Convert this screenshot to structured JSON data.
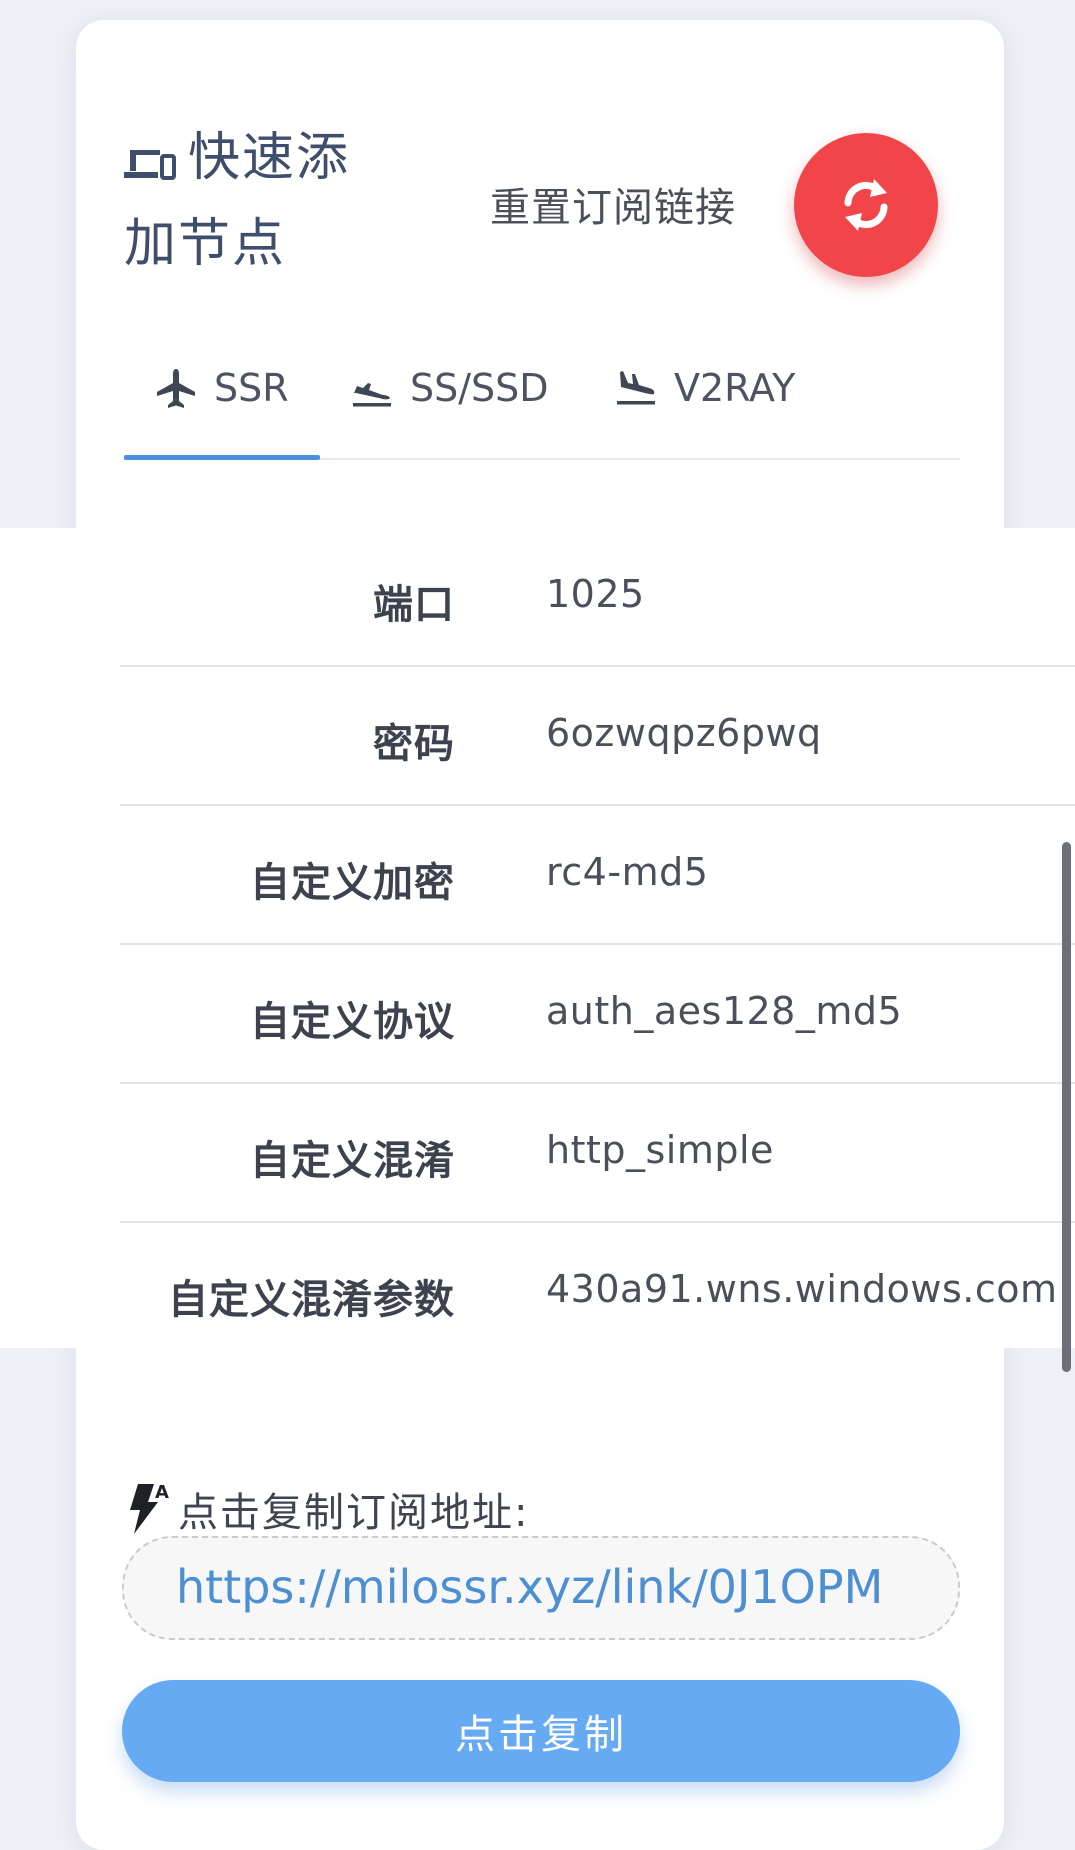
{
  "header": {
    "title": "快速添加节点",
    "reset_label": "重置订阅链接"
  },
  "tabs": [
    {
      "label": "SSR",
      "icon": "airplane-icon",
      "active": true
    },
    {
      "label": "SS/SSD",
      "icon": "airplane-departure-icon",
      "active": false
    },
    {
      "label": "V2RAY",
      "icon": "airplane-landing-icon",
      "active": false
    }
  ],
  "config": {
    "rows": [
      {
        "label": "端口",
        "value": "1025"
      },
      {
        "label": "密码",
        "value": "6ozwqpz6pwq"
      },
      {
        "label": "自定义加密",
        "value": "rc4-md5"
      },
      {
        "label": "自定义协议",
        "value": "auth_aes128_md5"
      },
      {
        "label": "自定义混淆",
        "value": "http_simple"
      },
      {
        "label": "自定义混淆参数",
        "value": "430a91.wns.windows.com"
      }
    ]
  },
  "subscription": {
    "label": "点击复制订阅地址:",
    "url": "https://milossr.xyz/link/0J1OPM",
    "copy_button": "点击复制"
  },
  "colors": {
    "accent": "#4a90d9",
    "reset_button": "#f1454a",
    "copy_button": "#65aaf3",
    "url_text": "#4c8fd3"
  }
}
